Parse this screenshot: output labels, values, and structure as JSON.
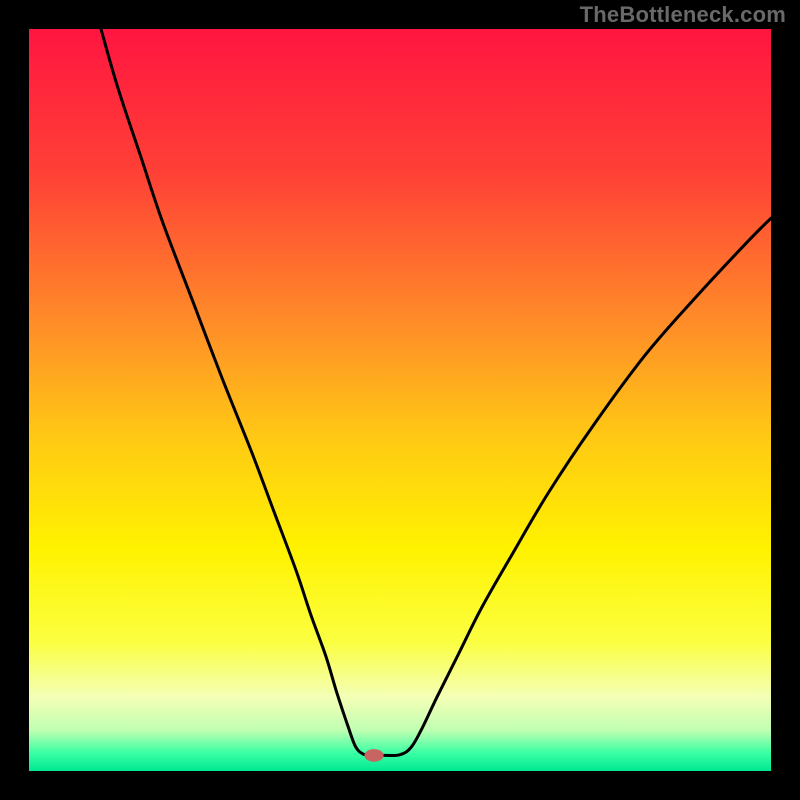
{
  "attribution": "TheBottleneck.com",
  "colors": {
    "frame": "#000000",
    "attribution": "#696969",
    "curve": "#000000",
    "marker_fill": "#c86462",
    "gradient_stops": [
      {
        "offset": 0.0,
        "color": "#ff1540"
      },
      {
        "offset": 0.2,
        "color": "#ff4236"
      },
      {
        "offset": 0.4,
        "color": "#ff8e28"
      },
      {
        "offset": 0.55,
        "color": "#ffc914"
      },
      {
        "offset": 0.7,
        "color": "#fff200"
      },
      {
        "offset": 0.825,
        "color": "#fbff40"
      },
      {
        "offset": 0.9,
        "color": "#f4ffb6"
      },
      {
        "offset": 0.945,
        "color": "#c0ffb2"
      },
      {
        "offset": 0.975,
        "color": "#3dffa5"
      },
      {
        "offset": 1.0,
        "color": "#00e893"
      }
    ]
  },
  "chart_data": {
    "type": "line",
    "title": "",
    "xlabel": "",
    "ylabel": "",
    "xlim": [
      0,
      100
    ],
    "ylim": [
      0,
      100
    ],
    "grid": false,
    "legend": null,
    "series": [
      {
        "name": "bottleneck-curve",
        "x": [
          9.7,
          12,
          15,
          18,
          22,
          26,
          30,
          33,
          36,
          38,
          40,
          41.5,
          43,
          44,
          45,
          46,
          48,
          50,
          51.5,
          53,
          55,
          58,
          61,
          65,
          70,
          76,
          83,
          90,
          97,
          100
        ],
        "y": [
          100,
          92,
          83,
          74,
          63.5,
          53,
          43,
          35,
          27,
          21,
          15.5,
          10.5,
          6,
          3.3,
          2.3,
          2.1,
          2.1,
          2.2,
          3.2,
          5.8,
          10,
          16,
          22,
          29,
          37.5,
          46.5,
          56,
          64,
          71.5,
          74.5
        ]
      }
    ],
    "marker": {
      "x": 46.5,
      "y": 2.1,
      "rx": 1.3,
      "ry": 0.85
    }
  }
}
